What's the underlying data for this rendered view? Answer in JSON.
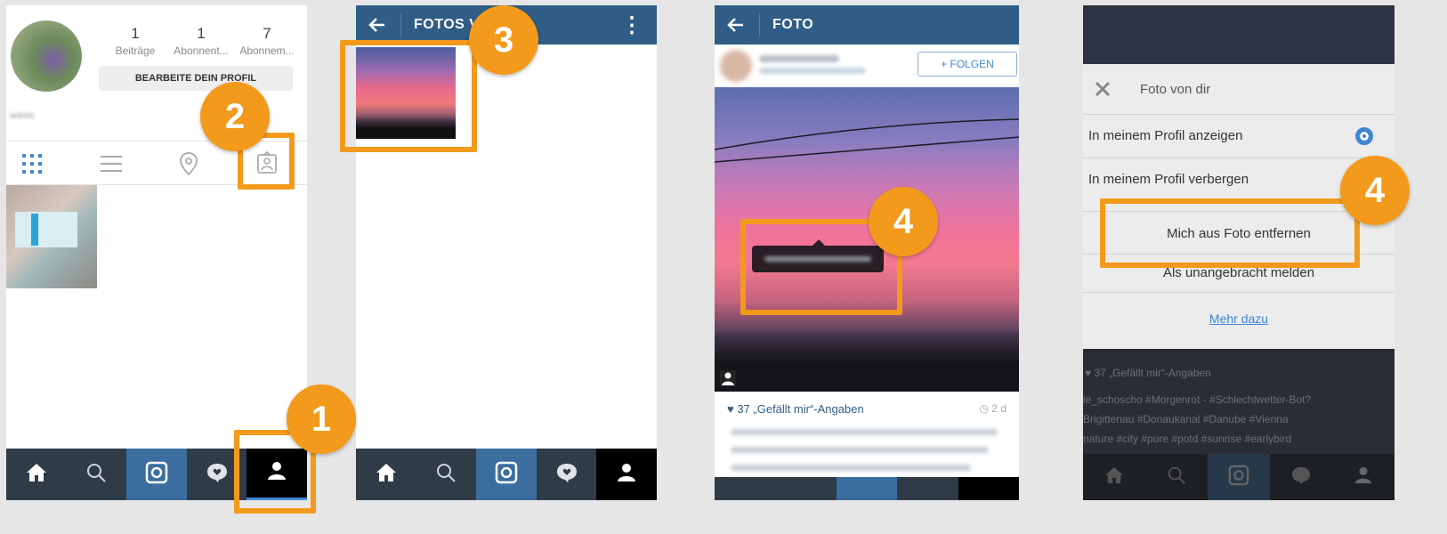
{
  "panel1": {
    "stats": [
      {
        "count": "1",
        "label": "Beiträge"
      },
      {
        "count": "1",
        "label": "Abonnent..."
      },
      {
        "count": "7",
        "label": "Abonnem..."
      }
    ],
    "edit_profile_label": "BEARBEITE DEIN PROFIL",
    "username": "weiss"
  },
  "panel2": {
    "title": "FOTOS VON",
    "menu_icon": "⋮"
  },
  "panel3": {
    "title": "FOTO",
    "follow_label": "+ FOLGEN",
    "likes": "♥ 37 „Gefällt mir“-Angaben",
    "time": "◷ 2 d"
  },
  "panel4": {
    "dialog_title": "Foto von dir",
    "option_show": "In meinem Profil anzeigen",
    "option_hide": "In meinem Profil verbergen",
    "remove": "Mich aus Foto entfernen",
    "report": "Als unangebracht melden",
    "more": "Mehr dazu",
    "bg_likes": "♥ 37 „Gefällt mir“-Angaben",
    "bg_caption_1": "ie_schoscho #Morgenrot - #Schlechtwetter-Bot?",
    "bg_caption_2": "Brigittenau #Donaukanal #Danube #Vienna",
    "bg_caption_3": "nature #city #pure #potd #sunrise #earlybird"
  },
  "badges": [
    "1",
    "2",
    "3",
    "4",
    "4"
  ],
  "colors": {
    "accent": "#f39a1c",
    "nav": "#2f3b47",
    "header": "#2f5d85",
    "active_tab": "#3b6e9f"
  }
}
